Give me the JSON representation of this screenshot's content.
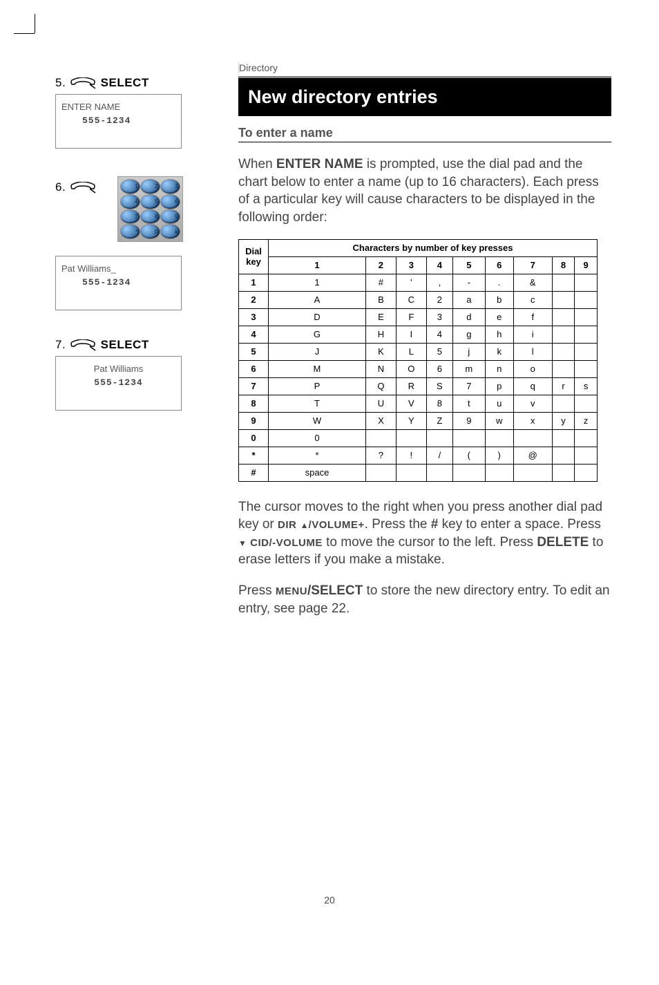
{
  "category": "Directory",
  "title": "New directory entries",
  "subheading": "To enter a name",
  "intro": "When ENTER NAME is prompted, use the dial pad and the chart below to enter a name (up to 16 characters). Each press of a particular key will cause characters to be displayed in the following order:",
  "steps": {
    "s5": {
      "num": "5.",
      "action": "SELECT",
      "line1": "ENTER NAME",
      "line2": "555-1234"
    },
    "s6": {
      "num": "6."
    },
    "s6b": {
      "line1": "Pat Williams_",
      "line2": "555-1234"
    },
    "s7": {
      "num": "7.",
      "action": "SELECT",
      "line1": "Pat Williams",
      "line2": "555-1234"
    }
  },
  "chart_data": {
    "type": "table",
    "title": "Characters by number of key presses",
    "row_header": "Dial key",
    "columns": [
      "1",
      "2",
      "3",
      "4",
      "5",
      "6",
      "7",
      "8",
      "9"
    ],
    "rows": [
      {
        "key": "1",
        "cells": [
          "1",
          "#",
          "'",
          ",",
          "-",
          ".",
          "&",
          "",
          ""
        ]
      },
      {
        "key": "2",
        "cells": [
          "A",
          "B",
          "C",
          "2",
          "a",
          "b",
          "c",
          "",
          ""
        ]
      },
      {
        "key": "3",
        "cells": [
          "D",
          "E",
          "F",
          "3",
          "d",
          "e",
          "f",
          "",
          ""
        ]
      },
      {
        "key": "4",
        "cells": [
          "G",
          "H",
          "I",
          "4",
          "g",
          "h",
          "i",
          "",
          ""
        ]
      },
      {
        "key": "5",
        "cells": [
          "J",
          "K",
          "L",
          "5",
          "j",
          "k",
          "l",
          "",
          ""
        ]
      },
      {
        "key": "6",
        "cells": [
          "M",
          "N",
          "O",
          "6",
          "m",
          "n",
          "o",
          "",
          ""
        ]
      },
      {
        "key": "7",
        "cells": [
          "P",
          "Q",
          "R",
          "S",
          "7",
          "p",
          "q",
          "r",
          "s"
        ]
      },
      {
        "key": "8",
        "cells": [
          "T",
          "U",
          "V",
          "8",
          "t",
          "u",
          "v",
          "",
          ""
        ]
      },
      {
        "key": "9",
        "cells": [
          "W",
          "X",
          "Y",
          "Z",
          "9",
          "w",
          "x",
          "y",
          "z"
        ]
      },
      {
        "key": "0",
        "cells": [
          "0",
          "",
          "",
          "",
          "",
          "",
          "",
          "",
          ""
        ]
      },
      {
        "key": "*",
        "cells": [
          "*",
          "?",
          "!",
          "/",
          "(",
          ")",
          "@",
          "",
          ""
        ]
      },
      {
        "key": "#",
        "cells": [
          "space",
          "",
          "",
          "",
          "",
          "",
          "",
          "",
          ""
        ]
      }
    ]
  },
  "para2_parts": {
    "a": "The cursor moves to the right when you press another dial pad key or ",
    "b": "DIR",
    "c": "/VOLUME+",
    "d": ". Press the ",
    "e": "#",
    "f": " key to enter a space. Press ",
    "g": "CID/-VOLUME",
    "h": " to move the cursor to the left. Press ",
    "i": "DELETE",
    "j": " to erase letters if you make a mistake."
  },
  "para3_parts": {
    "a": "Press ",
    "b": "MENU",
    "c": "/SELECT",
    "d": " to store the new directory entry. To edit an entry, see page 22."
  },
  "page_number": "20",
  "keypad_keys": [
    "1",
    "2",
    "3",
    "4",
    "5",
    "6",
    "7",
    "8",
    "9",
    "*",
    "0",
    "#"
  ]
}
